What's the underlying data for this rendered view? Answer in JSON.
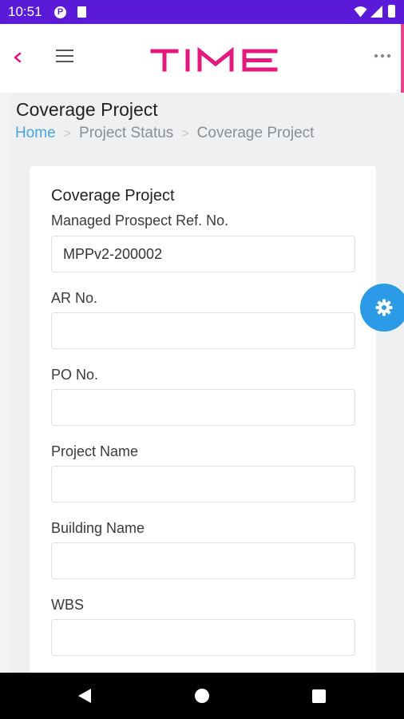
{
  "status_bar": {
    "time": "10:51",
    "p_badge": "P"
  },
  "app": {
    "logo_text": "TIME",
    "brand_color": "#e5187d",
    "accent_color": "#2b9be8"
  },
  "page": {
    "title": "Coverage Project",
    "breadcrumb": {
      "home": "Home",
      "parent": "Project Status",
      "current": "Coverage Project"
    }
  },
  "form": {
    "title": "Coverage Project",
    "fields": [
      {
        "label": "Managed Prospect Ref. No.",
        "value": "MPPv2-200002"
      },
      {
        "label": "AR No.",
        "value": ""
      },
      {
        "label": "PO No.",
        "value": ""
      },
      {
        "label": "Project Name",
        "value": ""
      },
      {
        "label": "Building Name",
        "value": ""
      },
      {
        "label": "WBS",
        "value": ""
      }
    ]
  },
  "icons": {
    "back": "chevron-left-icon",
    "menu": "hamburger-menu-icon",
    "more": "more-dots-icon",
    "settings": "gear-icon"
  }
}
